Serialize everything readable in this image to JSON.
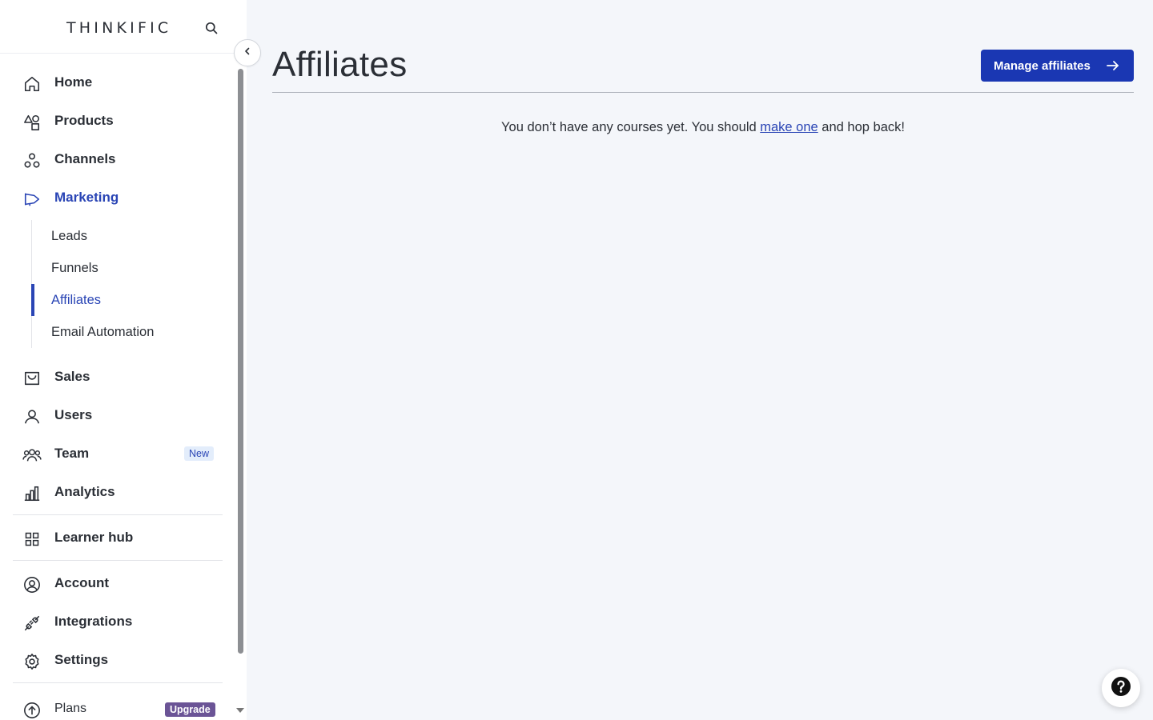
{
  "brand": {
    "logo_text": "THINKIFIC"
  },
  "sidebar": {
    "nav": [
      {
        "label": "Home",
        "icon": "home-icon"
      },
      {
        "label": "Products",
        "icon": "shapes-icon"
      },
      {
        "label": "Channels",
        "icon": "channels-icon"
      },
      {
        "label": "Marketing",
        "icon": "megaphone-icon",
        "active": true
      },
      {
        "label": "Sales",
        "icon": "sales-icon"
      },
      {
        "label": "Users",
        "icon": "user-icon"
      },
      {
        "label": "Team",
        "icon": "team-icon",
        "badge": "New"
      },
      {
        "label": "Analytics",
        "icon": "bar-chart-icon"
      },
      {
        "label": "Learner hub",
        "icon": "grid-icon"
      },
      {
        "label": "Account",
        "icon": "account-circle-icon"
      },
      {
        "label": "Integrations",
        "icon": "plug-icon"
      },
      {
        "label": "Settings",
        "icon": "gear-icon"
      },
      {
        "label": "Plans",
        "icon": "arrow-up-circle-icon",
        "badge": "Upgrade"
      }
    ],
    "marketing_sub": [
      {
        "label": "Leads"
      },
      {
        "label": "Funnels"
      },
      {
        "label": "Affiliates",
        "active": true
      },
      {
        "label": "Email Automation"
      }
    ]
  },
  "main": {
    "title": "Affiliates",
    "manage_button_label": "Manage affiliates",
    "empty_prefix": "You don’t have any courses yet. You should ",
    "empty_link": "make one",
    "empty_suffix": " and hop back!"
  },
  "colors": {
    "accent": "#1a37b3",
    "active_text": "#2a45b5",
    "upgrade_badge": "#6b5496",
    "new_badge_bg": "#e3edfb",
    "page_bg": "#f4f6fa"
  }
}
